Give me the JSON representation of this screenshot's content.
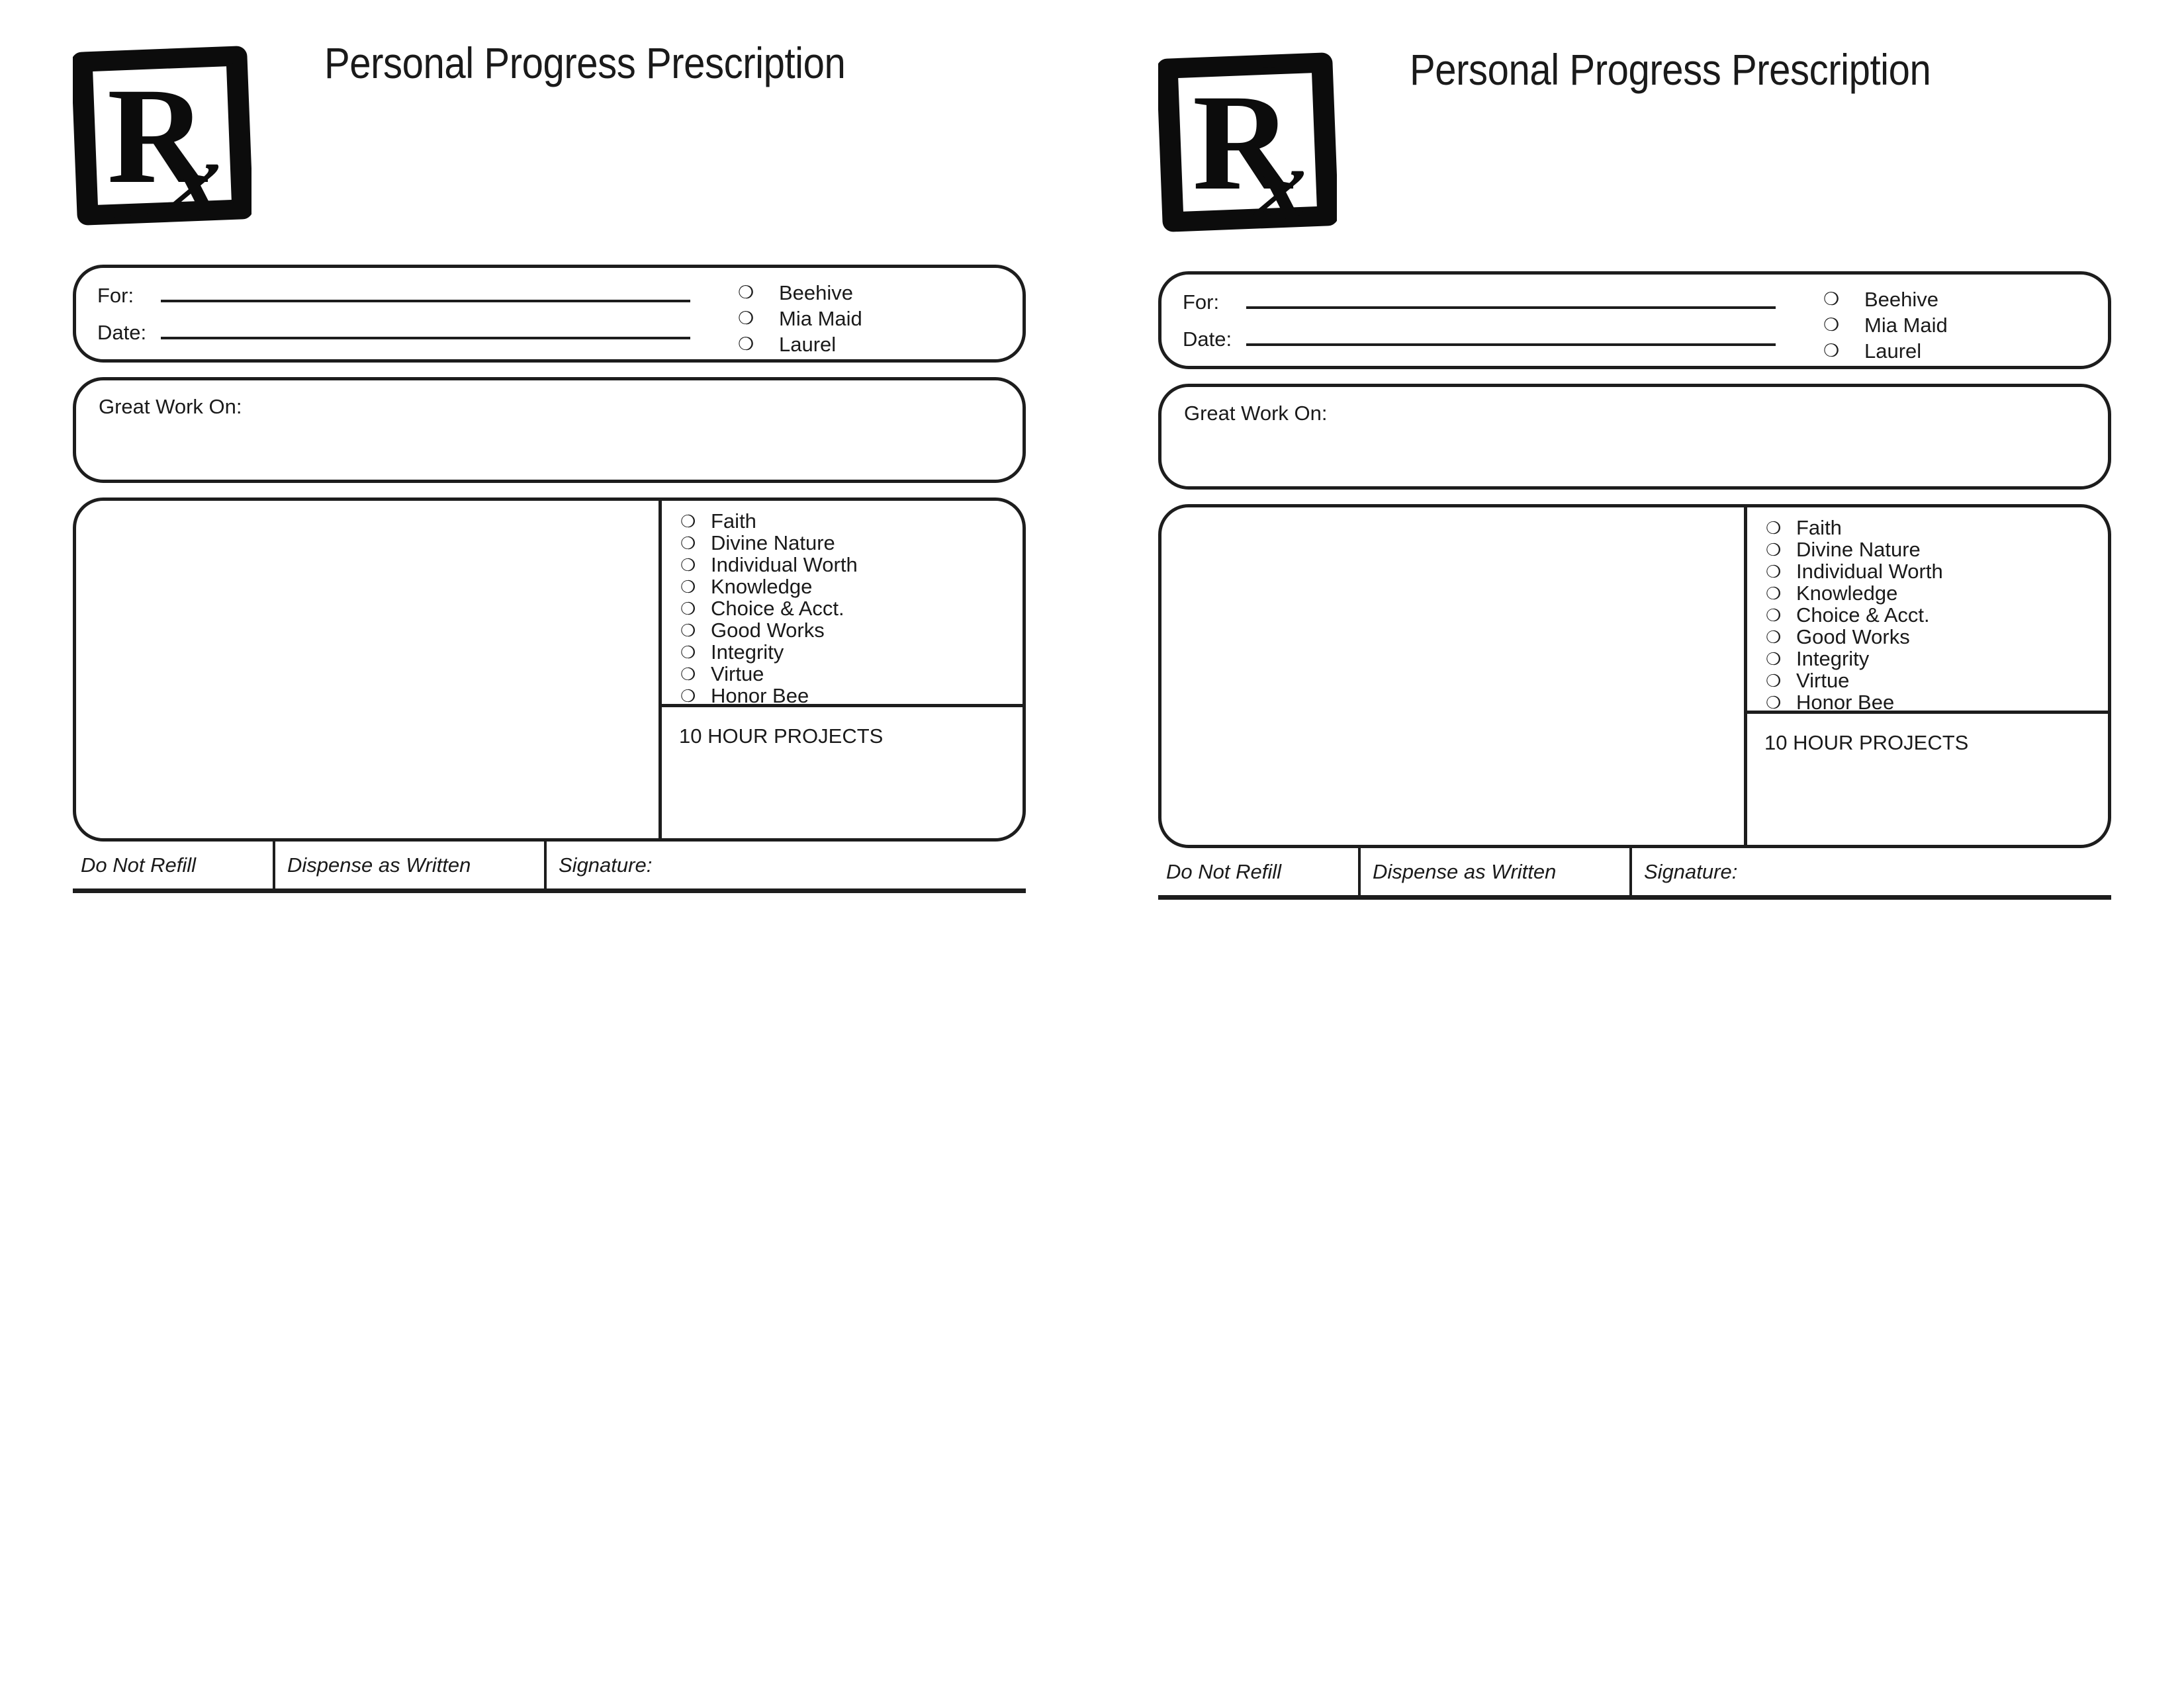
{
  "document": {
    "form_title": "Personal Progress Prescription",
    "logo_icon": "rx-prescription-icon",
    "logo_text_primary": "R",
    "logo_text_secondary": "x"
  },
  "identity": {
    "for_label": "For:",
    "date_label": "Date:",
    "for_value": "",
    "date_value": "",
    "bullet_glyph": "❍",
    "class_options": [
      {
        "label": "Beehive"
      },
      {
        "label": "Mia Maid"
      },
      {
        "label": "Laurel"
      }
    ]
  },
  "great_work": {
    "label": "Great Work On:",
    "value": ""
  },
  "body": {
    "notes_value": "",
    "bullet_glyph": "❍",
    "values": [
      {
        "label": "Faith"
      },
      {
        "label": "Divine Nature"
      },
      {
        "label": "Individual Worth"
      },
      {
        "label": "Knowledge"
      },
      {
        "label": "Choice & Acct."
      },
      {
        "label": "Good Works"
      },
      {
        "label": "Integrity"
      },
      {
        "label": "Virtue"
      },
      {
        "label": "Honor Bee"
      }
    ],
    "projects_label": "10 HOUR PROJECTS",
    "projects_value": ""
  },
  "footer": {
    "do_not_refill": "Do Not Refill",
    "dispense_as_written": "Dispense as Written",
    "signature": "Signature:",
    "signature_value": ""
  },
  "colors": {
    "ink": "#1d1d1d",
    "paper": "#ffffff"
  }
}
